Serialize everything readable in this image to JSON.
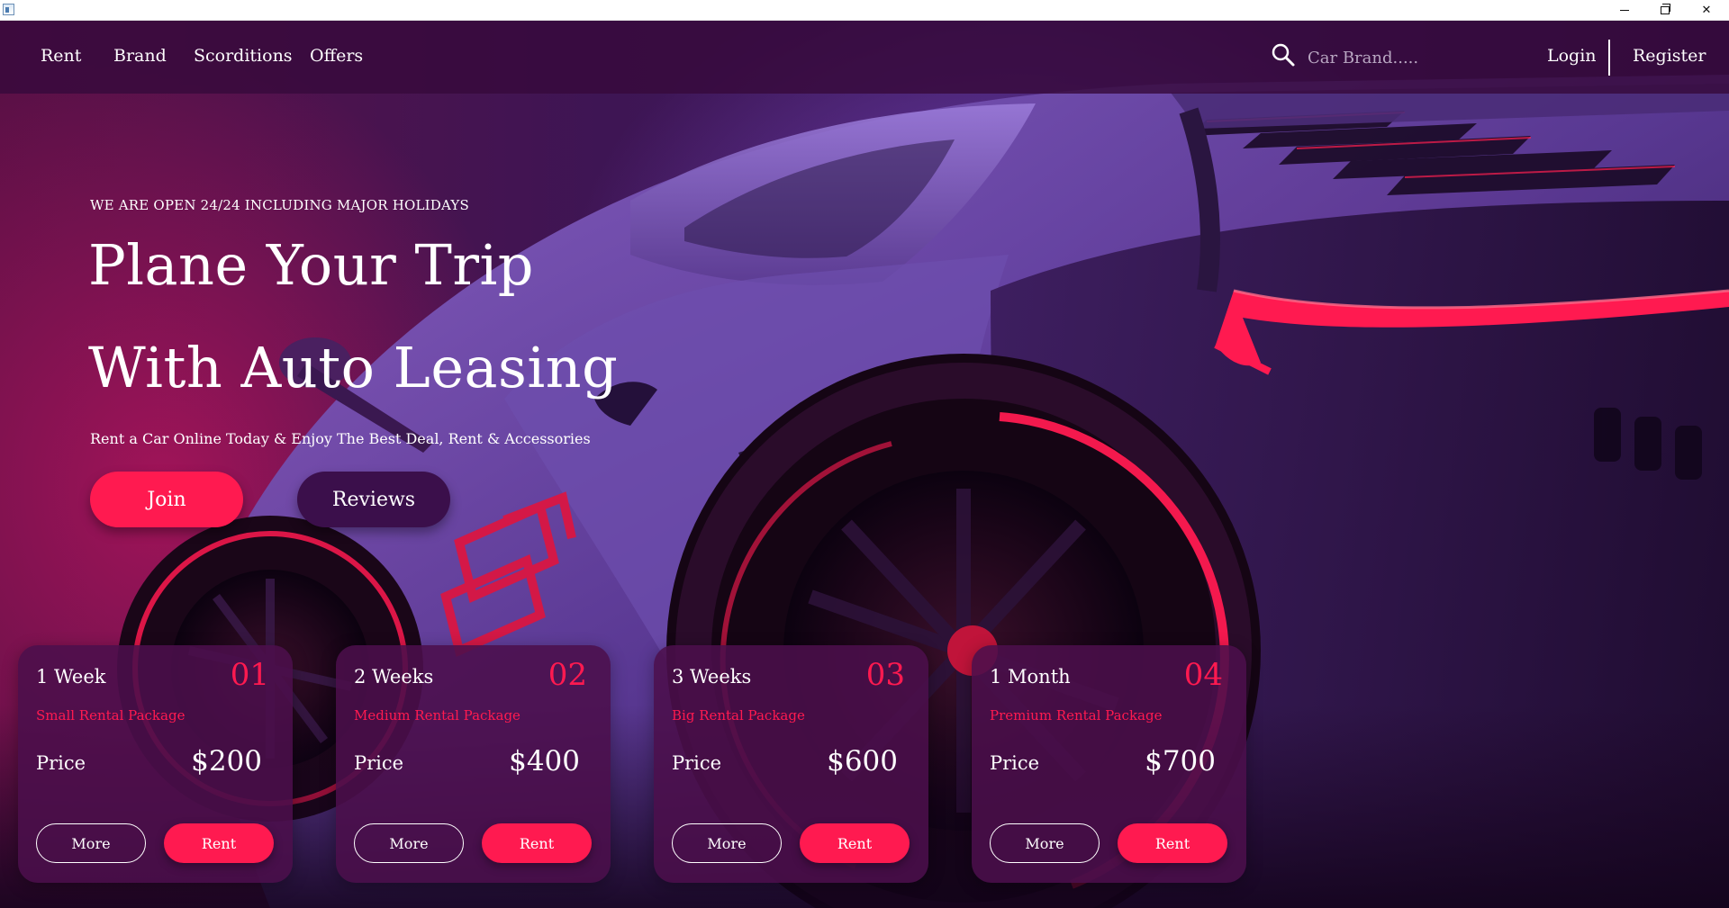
{
  "window": {
    "minimize_glyph": "",
    "close_glyph": "✕"
  },
  "nav": {
    "items": [
      {
        "label": "Rent"
      },
      {
        "label": "Brand"
      },
      {
        "label": "Scorditions"
      },
      {
        "label": "Offers"
      }
    ],
    "search": {
      "placeholder": "Car Brand.....",
      "icon": "search-icon"
    },
    "login_label": "Login",
    "register_label": "Register"
  },
  "hero": {
    "hours": "WE ARE OPEN 24/24 INCLUDING MAJOR HOLIDAYS",
    "headline_line1": "Plane Your Trip",
    "headline_line2": "With Auto Leasing",
    "tagline": "Rent a Car Online Today & Enjoy The Best Deal, Rent & Accessories",
    "join_label": "Join",
    "reviews_label": "Reviews"
  },
  "packages": [
    {
      "title": "1 Week",
      "number": "01",
      "subtitle": "Small Rental Package",
      "price_label": "Price",
      "price": "$200",
      "more_label": "More",
      "rent_label": "Rent"
    },
    {
      "title": "2 Weeks",
      "number": "02",
      "subtitle": "Medium Rental Package",
      "price_label": "Price",
      "price": "$400",
      "more_label": "More",
      "rent_label": "Rent"
    },
    {
      "title": "3 Weeks",
      "number": "03",
      "subtitle": "Big Rental Package",
      "price_label": "Price",
      "price": "$600",
      "more_label": "More",
      "rent_label": "Rent"
    },
    {
      "title": "1 Month",
      "number": "04",
      "subtitle": "Premium Rental Package",
      "price_label": "Price",
      "price": "$700",
      "more_label": "More",
      "rent_label": "Rent"
    }
  ],
  "colors": {
    "accent": "#ff1a50",
    "nav_bg": "#370a3c",
    "card_bg": "#4b0f4b",
    "reviews_bg": "#3b0f4b"
  }
}
